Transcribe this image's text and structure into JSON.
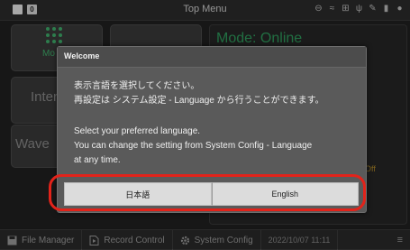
{
  "titlebar": {
    "title": "Top Menu",
    "badge": "0",
    "icons": [
      "recording-icon",
      "wifi-icon",
      "network-icon",
      "usb-icon",
      "tool-icon",
      "battery-icon",
      "power-icon"
    ]
  },
  "background": {
    "tile_labels": [
      "Mo",
      "Inter",
      "Wave"
    ],
    "mode_label": "Mode: Online",
    "off_label": "Off"
  },
  "bottombar": {
    "items": [
      "File Manager",
      "Record Control",
      "System Config"
    ],
    "clock": "2022/10/07 11:11"
  },
  "dialog": {
    "title": "Welcome",
    "jp_line1": "表示言語を選択してください。",
    "jp_line2": "再設定は システム設定 - Language から行うことができます。",
    "en_line1": "Select your preferred language.",
    "en_line2": "You can change the setting from System Config - Language",
    "en_line3": "at any time.",
    "buttons": [
      "日本語",
      "English"
    ]
  },
  "colors": {
    "highlight": "#e2231a",
    "accent_green": "#2f9a5c"
  }
}
